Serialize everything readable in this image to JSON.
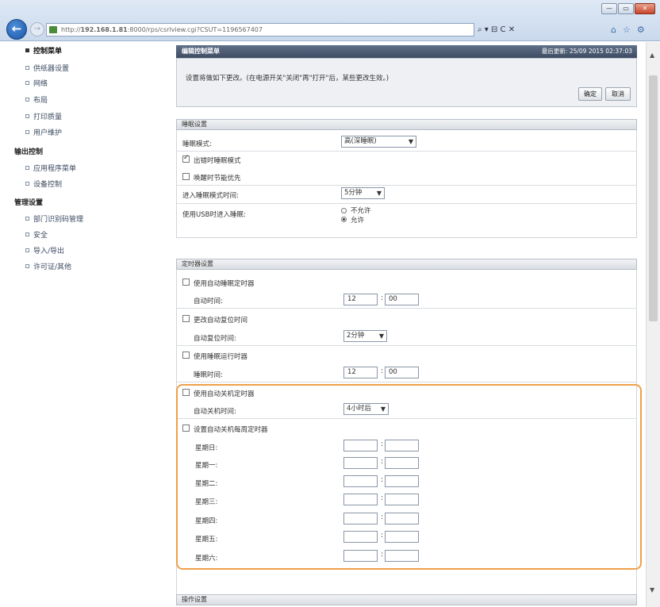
{
  "browser": {
    "url_prefix": "http://",
    "url_host": "192.168.1.81",
    "url_rest": ":8000/rps/csrlview.cgi?CSUT=1196567407",
    "address_tools": "⌕ ▾ ⊟ C ✕",
    "right_tools": [
      "⌂",
      "☆",
      "⚙"
    ],
    "window_buttons": [
      "—",
      "▭",
      "✕"
    ]
  },
  "nav": {
    "items_top": [
      "控制菜单",
      "供纸器设置",
      "网络",
      "布局",
      "打印质量",
      "用户维护"
    ],
    "group1": "输出控制",
    "items_mid": [
      "应用程序菜单",
      "设备控制"
    ],
    "group2": "管理设置",
    "items_bot": [
      "部门识别码管理",
      "安全",
      "导入/导出",
      "许可证/其他"
    ]
  },
  "header": {
    "title": "编辑控制菜单",
    "updated": "最后更新: 25/09 2015 02:37:03",
    "notice": "设置将做如下更改。(在电源开关\"关闭\"再\"打开\"后，某些更改生效。)",
    "ok": "确定",
    "cancel": "取消"
  },
  "sleep": {
    "heading": "睡眠设置",
    "mode_label": "睡眠模式:",
    "mode_value": "高(深睡眠)",
    "chk_exit": "出错时睡眠模式",
    "chk_exit_on": true,
    "chk_quick": "唤醒时节能优先",
    "chk_quick_on": false,
    "enter_label": "进入睡眠模式时间:",
    "enter_value": "5分钟",
    "usb_label": "使用USB时进入睡眠:",
    "usb_opt1": "不允许",
    "usb_opt2": "允许",
    "usb_selected": 2
  },
  "timer": {
    "heading": "定时器设置",
    "auto_sleep_chk": "使用自动睡眠定时器",
    "auto_sleep_time_label": "自动时间:",
    "auto_sleep_h": "12",
    "auto_sleep_m": "00",
    "auto_reset_chk": "更改自动复位时间",
    "auto_reset_label": "自动复位时间:",
    "auto_reset_value": "2分钟",
    "wake_chk": "使用睡眠运行时器",
    "wake_label": "睡眠时间:",
    "wake_h": "12",
    "wake_m": "00",
    "auto_off_chk": "使用自动关机定时器",
    "auto_off_label": "自动关机时间:",
    "auto_off_value": "4小时后",
    "weekly_chk": "设置自动关机每周定时器",
    "days": [
      "星期日:",
      "星期一:",
      "星期二:",
      "星期三:",
      "星期四:",
      "星期五:",
      "星期六:"
    ]
  },
  "bottom_heading": "操作设置"
}
